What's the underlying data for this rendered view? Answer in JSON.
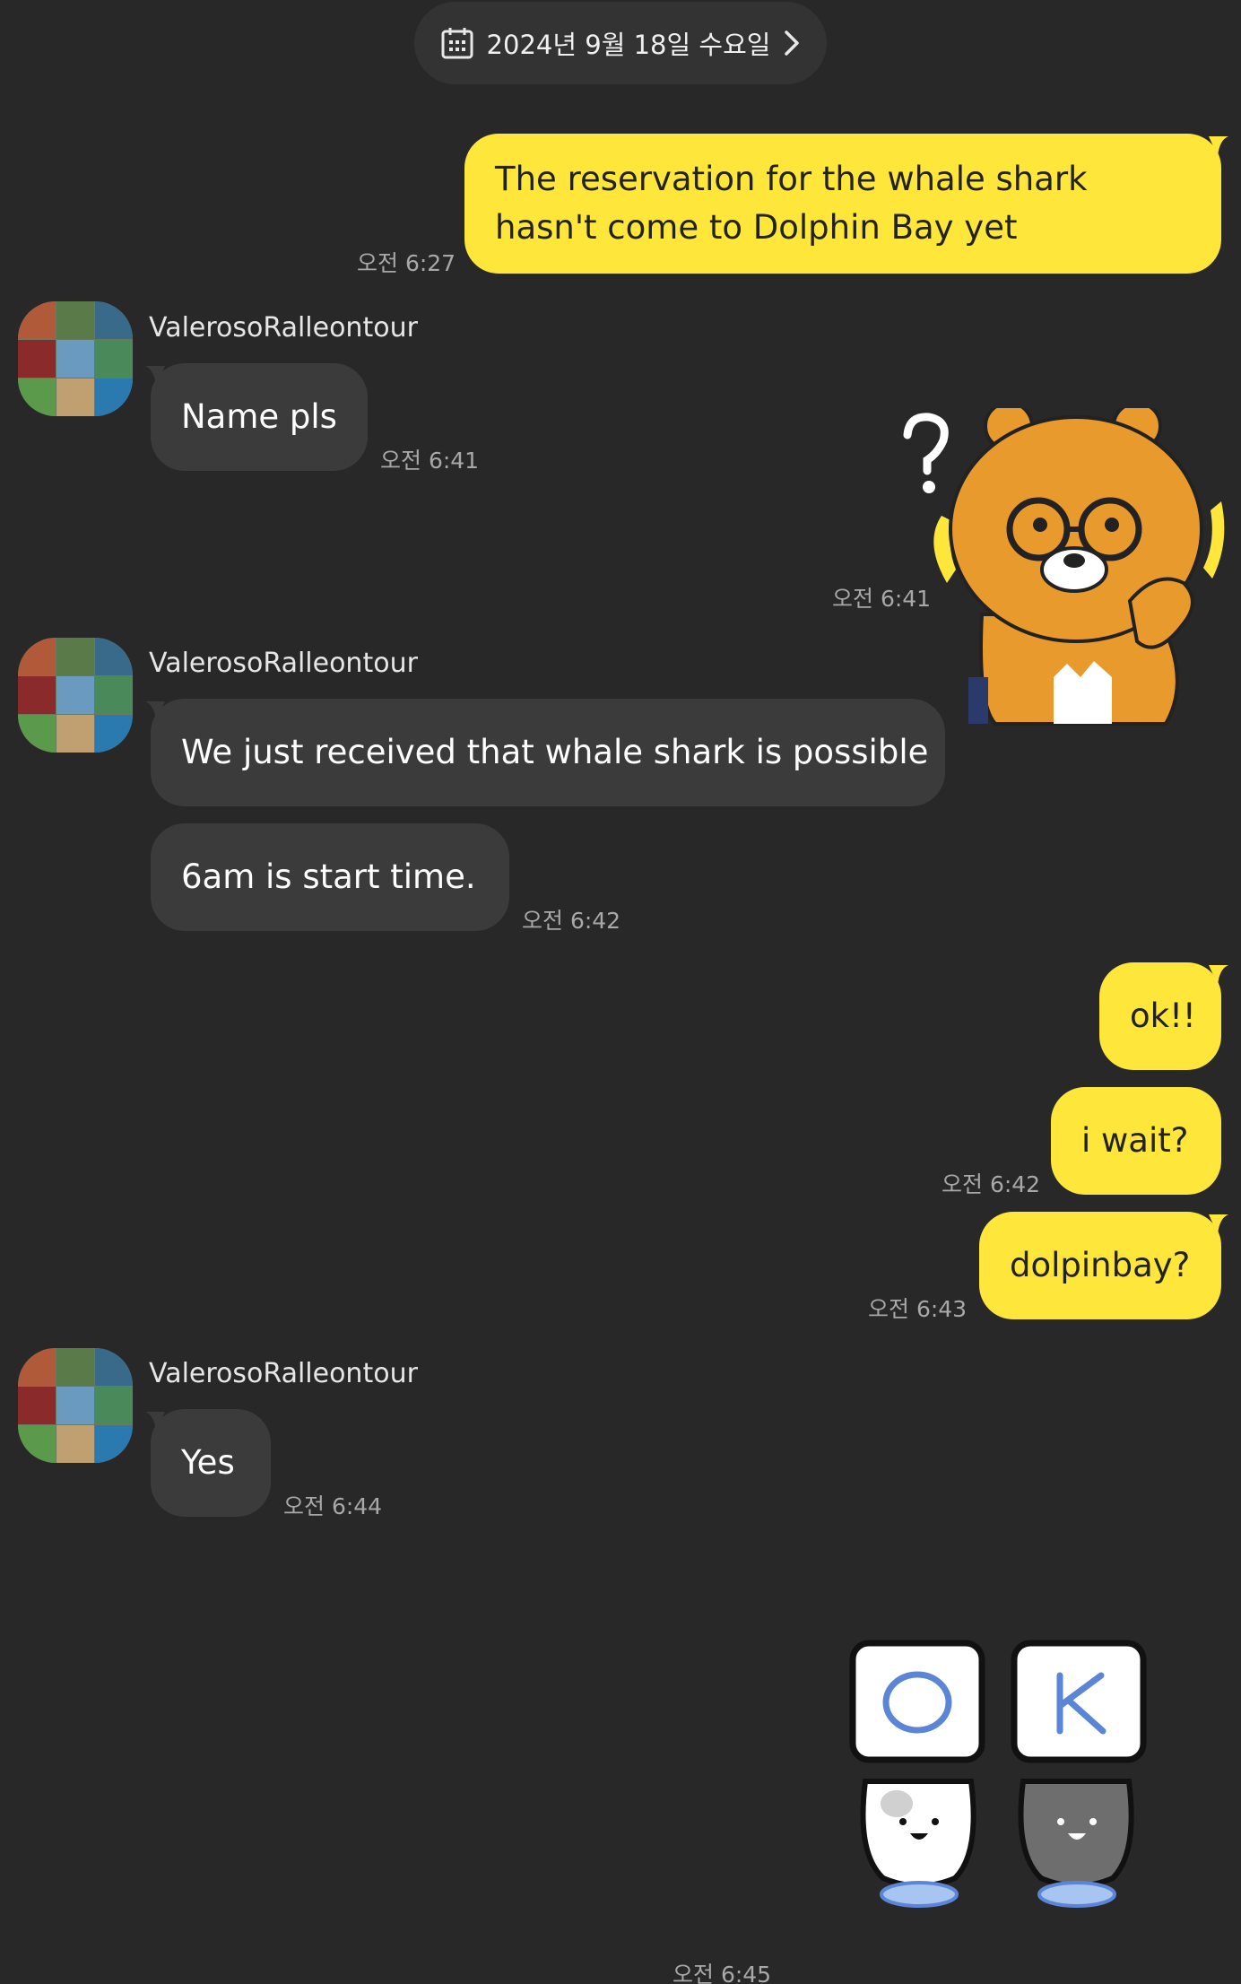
{
  "date_separator": {
    "text": "2024년 9월 18일 수요일"
  },
  "messages": {
    "m1": {
      "text": "The reservation for the whale shark hasn't come to Dolphin Bay yet",
      "time": "오전 6:27"
    },
    "g1": {
      "sender": "ValerosoRalleontour",
      "text": "Name pls",
      "time": "오전 6:41"
    },
    "s1": {
      "time": "오전 6:41"
    },
    "g2": {
      "sender": "ValerosoRalleontour",
      "text1": "We just received that whale shark is possible",
      "text2": "6am is start time.",
      "time": "오전 6:42"
    },
    "m2": {
      "text": "ok!!"
    },
    "m3": {
      "text": "i wait?",
      "time": "오전 6:42"
    },
    "m4": {
      "text": "dolpinbay?",
      "time": "오전 6:43"
    },
    "g3": {
      "sender": "ValerosoRalleontour",
      "text": "Yes",
      "time": "오전 6:44"
    },
    "s2": {
      "time": "오전 6:45"
    }
  },
  "stickers": {
    "bear": {
      "icon": "confused-bear-sticker-icon",
      "color": "#e89a2c"
    },
    "ok_cats": {
      "icon": "ok-cats-sticker-icon",
      "left_sign": "O",
      "right_sign": "K",
      "sign_color": "#5b86d6"
    }
  },
  "colors": {
    "background": "#282828",
    "my_bubble": "#fee63a",
    "their_bubble": "#3b3b3b",
    "timestamp": "#a8a8a8"
  }
}
